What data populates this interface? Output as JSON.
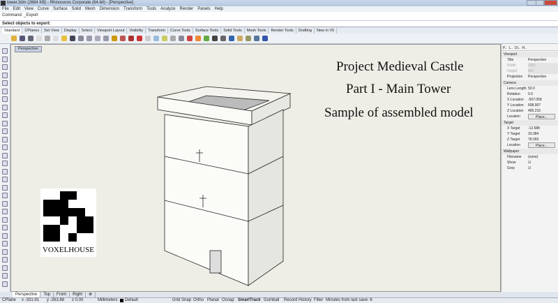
{
  "window": {
    "title": "tower.3dm (2684 KB) - Rhinoceros Corporate (64-bit) - [Perspective]"
  },
  "menu": [
    "File",
    "Edit",
    "View",
    "Curve",
    "Surface",
    "Solid",
    "Mesh",
    "Dimension",
    "Transform",
    "Tools",
    "Analyze",
    "Render",
    "Panels",
    "Help"
  ],
  "command": {
    "history": "Command: _Export",
    "prompt": "Select objects to export:"
  },
  "toolbar_tabs": [
    "Standard",
    "CPlanes",
    "Set View",
    "Display",
    "Select",
    "Viewport Layout",
    "Visibility",
    "Transform",
    "Curve Tools",
    "Surface Tools",
    "Solid Tools",
    "Mesh Tools",
    "Render Tools",
    "Drafting",
    "New in V5"
  ],
  "viewport": {
    "label": "Perspective",
    "title_lines": [
      "Project Medieval Castle",
      "Part I - Main Tower",
      "Sample of assembled model"
    ],
    "logo_text": "VOXELHOUSE"
  },
  "panel": {
    "tabs": [
      "P..",
      "L..",
      "Di..",
      "H.."
    ],
    "viewport_section": "Viewport",
    "title_label": "Title",
    "title": "Perspective",
    "width_label": "Width",
    "width": "1601",
    "height_label": "Height",
    "height": "842",
    "projection_label": "Projection",
    "projection": "Perspective",
    "camera_section": "Camera",
    "lens_label": "Lens Length",
    "lens": "50.0",
    "rotation_label": "Rotation",
    "rotation": "0.0",
    "xloc_label": "X Location",
    "xloc": "-507.058",
    "yloc_label": "Y Location",
    "yloc": "698.907",
    "zloc_label": "Z Location",
    "zloc": "495.215",
    "location_label": "Location",
    "place": "Place...",
    "target_section": "Target",
    "xt_label": "X Target",
    "xt": "-12.588",
    "yt_label": "Y Target",
    "yt": "33.084",
    "zt_label": "Z Target",
    "zt": "78.093",
    "wallpaper_section": "Wallpaper",
    "filename_label": "Filename",
    "filename": "(none)",
    "show_label": "Show",
    "gray_label": "Gray",
    "check": "☑"
  },
  "viewport_tabs": [
    "Perspective",
    "Top",
    "Front",
    "Right",
    "⊕"
  ],
  "status": {
    "cplane": "CPlane",
    "x": "x -331.91",
    "y": "y -263.88",
    "z": "z 0.00",
    "units": "Millimeters",
    "layer": "Default",
    "grid_snap": "Grid Snap",
    "ortho": "Ortho",
    "planar": "Planar",
    "osnap": "Osnap",
    "smarttrack": "SmartTrack",
    "gumball": "Gumball",
    "record_history": "Record History",
    "filter": "Filter",
    "minutes": "Minutes from last save: 6"
  }
}
